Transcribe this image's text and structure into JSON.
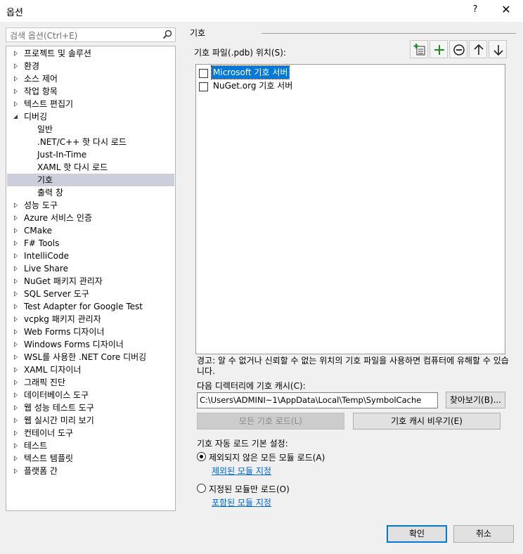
{
  "window": {
    "title": "옵션",
    "help": "?",
    "close": "✕"
  },
  "search": {
    "placeholder": "검색 옵션(Ctrl+E)"
  },
  "tree": {
    "items": [
      {
        "label": "프로젝트 및 솔루션",
        "level": 0,
        "expander": "collapsed"
      },
      {
        "label": "환경",
        "level": 0,
        "expander": "collapsed"
      },
      {
        "label": "소스 제어",
        "level": 0,
        "expander": "collapsed"
      },
      {
        "label": "작업 항목",
        "level": 0,
        "expander": "collapsed"
      },
      {
        "label": "텍스트 편집기",
        "level": 0,
        "expander": "collapsed"
      },
      {
        "label": "디버깅",
        "level": 0,
        "expander": "expanded"
      },
      {
        "label": "일반",
        "level": 1,
        "expander": "none"
      },
      {
        "label": ".NET/C++ 핫 다시 로드",
        "level": 1,
        "expander": "none"
      },
      {
        "label": "Just-In-Time",
        "level": 1,
        "expander": "none"
      },
      {
        "label": "XAML 핫 다시 로드",
        "level": 1,
        "expander": "none"
      },
      {
        "label": "기호",
        "level": 1,
        "expander": "none",
        "selected": true
      },
      {
        "label": "출력 창",
        "level": 1,
        "expander": "none"
      },
      {
        "label": "성능 도구",
        "level": 0,
        "expander": "collapsed"
      },
      {
        "label": "Azure 서비스 인증",
        "level": 0,
        "expander": "collapsed"
      },
      {
        "label": "CMake",
        "level": 0,
        "expander": "collapsed"
      },
      {
        "label": "F# Tools",
        "level": 0,
        "expander": "collapsed"
      },
      {
        "label": "IntelliCode",
        "level": 0,
        "expander": "collapsed"
      },
      {
        "label": "Live Share",
        "level": 0,
        "expander": "collapsed"
      },
      {
        "label": "NuGet 패키지 관리자",
        "level": 0,
        "expander": "collapsed"
      },
      {
        "label": "SQL Server 도구",
        "level": 0,
        "expander": "collapsed"
      },
      {
        "label": "Test Adapter for Google Test",
        "level": 0,
        "expander": "collapsed"
      },
      {
        "label": "vcpkg 패키지 관리자",
        "level": 0,
        "expander": "collapsed"
      },
      {
        "label": "Web Forms 디자이너",
        "level": 0,
        "expander": "collapsed"
      },
      {
        "label": "Windows Forms 디자이너",
        "level": 0,
        "expander": "collapsed"
      },
      {
        "label": "WSL를 사용한 .NET Core 디버깅",
        "level": 0,
        "expander": "collapsed"
      },
      {
        "label": "XAML 디자이너",
        "level": 0,
        "expander": "collapsed"
      },
      {
        "label": "그래픽 진단",
        "level": 0,
        "expander": "collapsed"
      },
      {
        "label": "데이터베이스 도구",
        "level": 0,
        "expander": "collapsed"
      },
      {
        "label": "웹 성능 테스트 도구",
        "level": 0,
        "expander": "collapsed"
      },
      {
        "label": "웹 실시간 미리 보기",
        "level": 0,
        "expander": "collapsed"
      },
      {
        "label": "컨테이너 도구",
        "level": 0,
        "expander": "collapsed"
      },
      {
        "label": "테스트",
        "level": 0,
        "expander": "collapsed"
      },
      {
        "label": "텍스트 템플릿",
        "level": 0,
        "expander": "collapsed"
      },
      {
        "label": "플랫폼 간",
        "level": 0,
        "expander": "collapsed"
      }
    ]
  },
  "symbols": {
    "section_title": "기호",
    "locations_label": "기호 파일(.pdb) 위치(S):",
    "toolbar_icons": [
      "add-pdb-icon",
      "add-icon",
      "remove-icon",
      "move-up-icon",
      "move-down-icon"
    ],
    "locations": [
      {
        "label": "Microsoft 기호 서버",
        "checked": false,
        "selected": true
      },
      {
        "label": "NuGet.org 기호 서버",
        "checked": false,
        "selected": false
      }
    ],
    "warning": "경고: 알 수 없거나 신뢰할 수 없는 위치의 기호 파일을 사용하면 컴퓨터에 유해할 수 있습니다.",
    "cache_label": "다음 디렉터리에 기호 캐시(C):",
    "cache_path": "C:\\Users\\ADMINI~1\\AppData\\Local\\Temp\\SymbolCache",
    "browse_button": "찾아보기(B)...",
    "load_all_button": "모든 기호 로드(L)",
    "empty_cache_button": "기호 캐시 비우기(E)",
    "auto_load_label": "기호 자동 로드 기본 설정:",
    "radio_all": "제외되지 않은 모든 모듈 로드(A)",
    "radio_all_selected": true,
    "link_excluded": "제외된 모듈 지정",
    "radio_specified": "지정된 모듈만 로드(O)",
    "radio_specified_selected": false,
    "link_included": "포함된 모듈 지정"
  },
  "footer": {
    "ok": "확인",
    "cancel": "취소"
  },
  "colors": {
    "accent": "#0078d7",
    "tree_selection": "#cccedb",
    "link": "#0066cc",
    "add_icon": "#1f8a1f"
  }
}
